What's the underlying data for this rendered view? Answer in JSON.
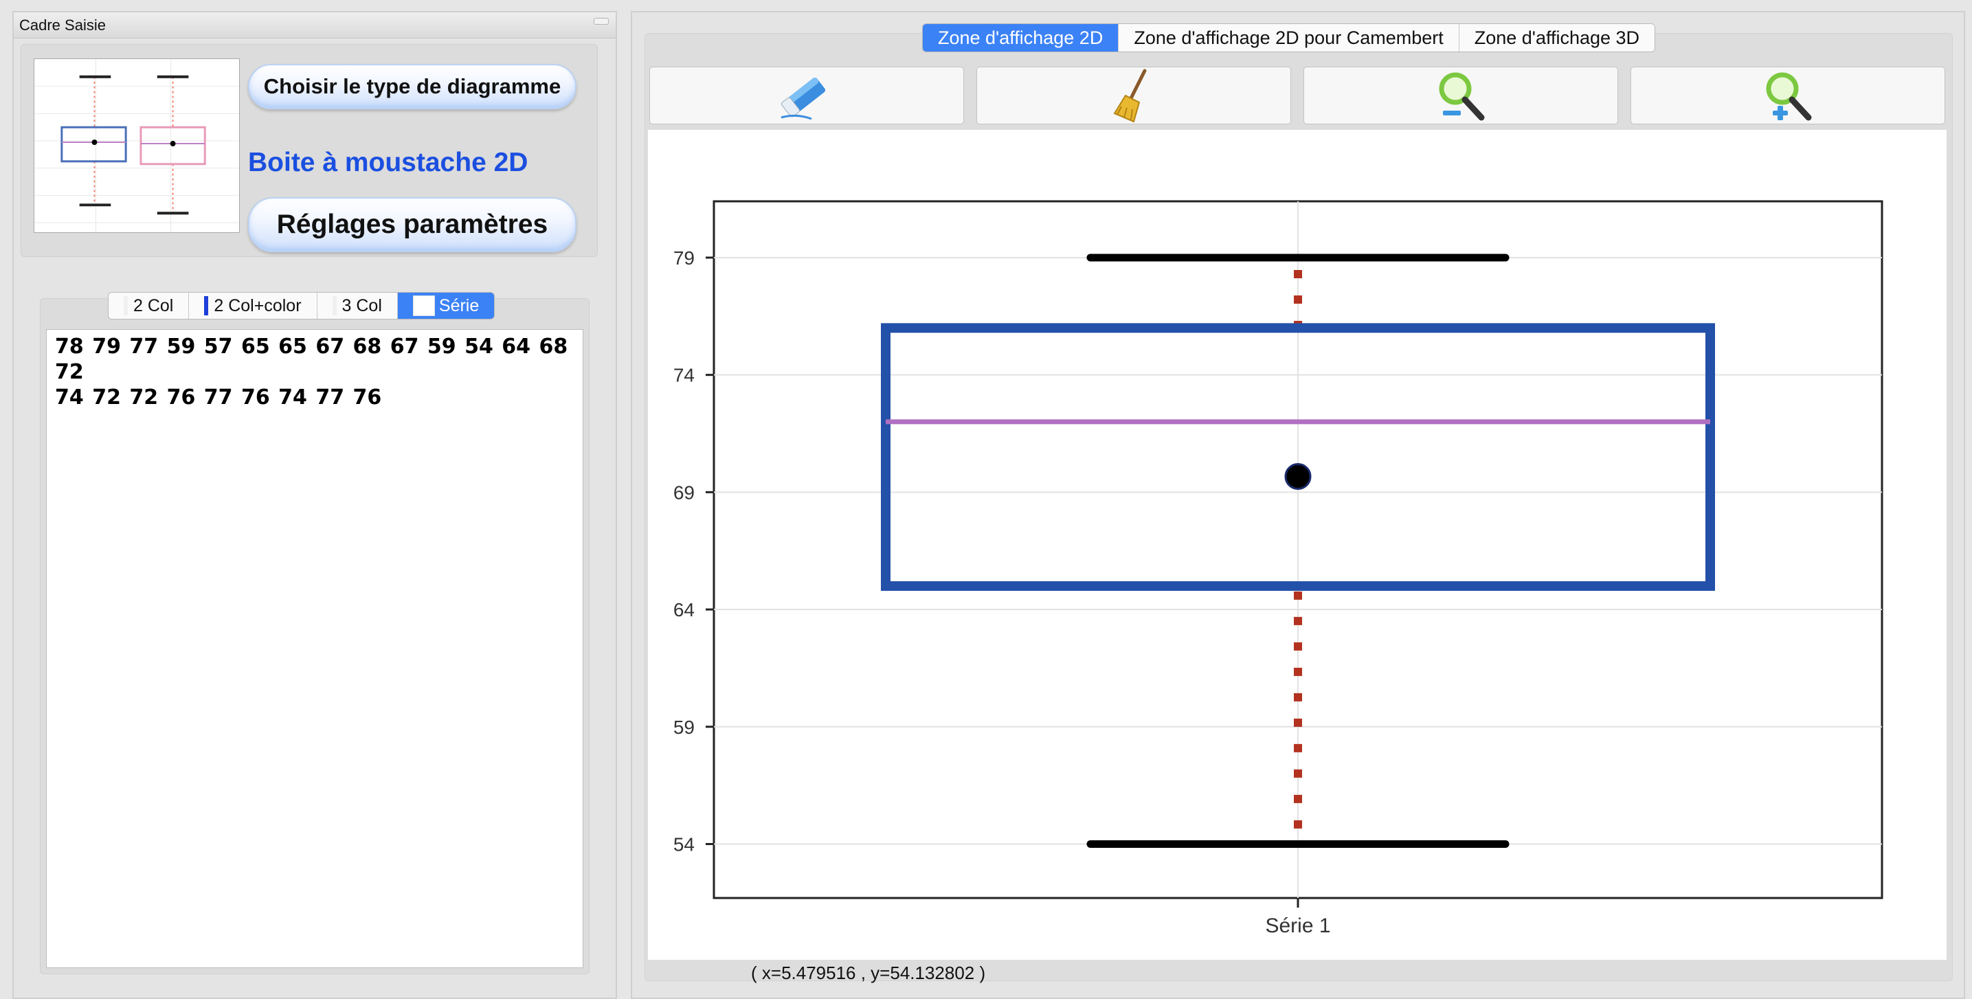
{
  "left_panel": {
    "title": "Cadre Saisie",
    "choose_button": "Choisir le type de diagramme",
    "chart_type_label": "Boite à moustache 2D",
    "settings_button": "Réglages paramètres",
    "data_modes": [
      {
        "label": "2 Col",
        "active": false
      },
      {
        "label": "2 Col+color",
        "active": false
      },
      {
        "label": "3 Col",
        "active": false
      },
      {
        "label": "Série",
        "active": true
      }
    ],
    "data_text": "78 79 77 59 57 65 65 67 68 67 59 54 64 68 72\n74 72 72 76 77 76 74 77 76"
  },
  "right_panel": {
    "tabs": [
      {
        "label": "Zone d'affichage 2D",
        "active": true
      },
      {
        "label": "Zone d'affichage 2D pour Camembert",
        "active": false
      },
      {
        "label": "Zone d'affichage 3D",
        "active": false
      }
    ],
    "tools": [
      {
        "icon": "eraser-icon"
      },
      {
        "icon": "broom-icon"
      },
      {
        "icon": "zoom-out-icon"
      },
      {
        "icon": "zoom-in-icon"
      }
    ],
    "coordinates": "( x=5.479516 , y=54.132802 )"
  },
  "colors": {
    "tab_active": "#3b82f6",
    "label_blue": "#1b4fe0",
    "box_blue": "#2350a8",
    "median_purple": "#b06fc0",
    "whisker_red": "#b3321f"
  },
  "chart_data": {
    "type": "box",
    "categories": [
      "Série 1"
    ],
    "box": {
      "whisker_low": 54,
      "q1": 65,
      "median": 72,
      "mean": 69.67,
      "q3": 76,
      "whisker_high": 79
    },
    "ylim": [
      51.7,
      81.4
    ],
    "yticks": [
      54,
      59,
      64,
      69,
      74,
      79
    ],
    "ytick_labels": [
      "54",
      "59",
      "64",
      "69",
      "74",
      "79"
    ],
    "grid": true
  }
}
